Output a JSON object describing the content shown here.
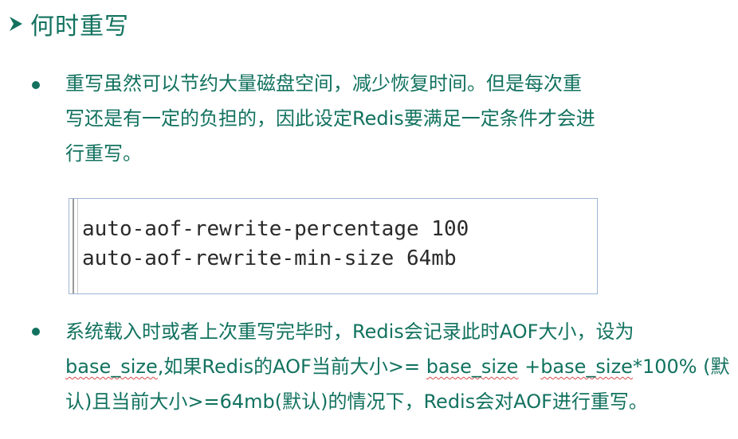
{
  "heading": {
    "title": "何时重写"
  },
  "bullet1": {
    "lines": [
      "重写虽然可以节约大量磁盘空间，减少恢复时间。但是每次重",
      "写还是有一定的负担的，因此设定Redis要满足一定条件才会进",
      "行重写。"
    ]
  },
  "config": {
    "lines": [
      "auto-aof-rewrite-percentage 100",
      "auto-aof-rewrite-min-size 64mb"
    ]
  },
  "bullet2": {
    "line1": "系统载入时或者上次重写完毕时，Redis会记录此时AOF大小，设为",
    "line2_parts": [
      "base_size",
      ",如果Redis的AOF当前大小>= ",
      "base_size",
      " +",
      "base_size",
      "*100% (默"
    ],
    "line3": "认)且当前大小>=64mb(默认)的情况下，Redis会对AOF进行重写。"
  },
  "colors": {
    "text": "#12725f",
    "code_text": "#2a2a2a",
    "code_border": "#9fb5d6",
    "spellcheck_underline": "#d84a4a"
  }
}
